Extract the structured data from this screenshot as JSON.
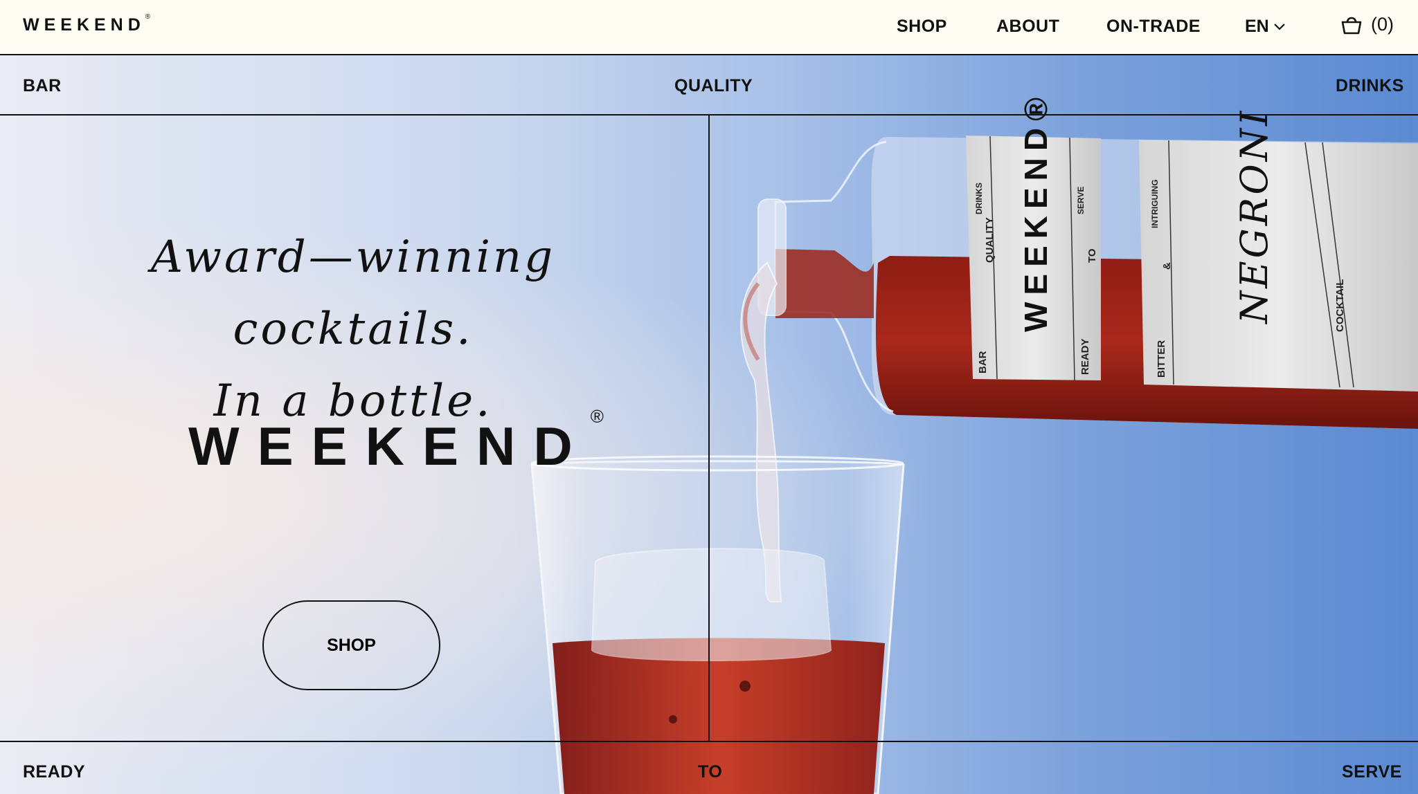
{
  "header": {
    "logo": "WEEKEND",
    "logo_mark": "®",
    "nav": {
      "shop": "SHOP",
      "about": "ABOUT",
      "on_trade": "ON-TRADE"
    },
    "language": "EN",
    "cart_count": "(0)"
  },
  "hero": {
    "band_top": {
      "left": "BAR",
      "center": "QUALITY",
      "right": "DRINKS"
    },
    "band_bottom": {
      "left": "READY",
      "center": "TO",
      "right": "SERVE"
    },
    "headline_line1": "Award—winning cocktails.",
    "headline_line2": "In a bottle.",
    "brand": "WEEKEND",
    "brand_mark": "®",
    "cta": "SHOP"
  },
  "bottle_label": {
    "brand": "WEEKEND®",
    "words": [
      "DRINKS",
      "QUALITY",
      "BAR",
      "SERVE",
      "TO",
      "READY",
      "INTRIGUING",
      "&",
      "BITTER",
      "COCKTAIL"
    ],
    "product": "NEGRONI"
  },
  "colors": {
    "ink": "#111111",
    "cream": "#fffdf3",
    "negroni": "#b3251a",
    "sky": "#6d96d6"
  }
}
